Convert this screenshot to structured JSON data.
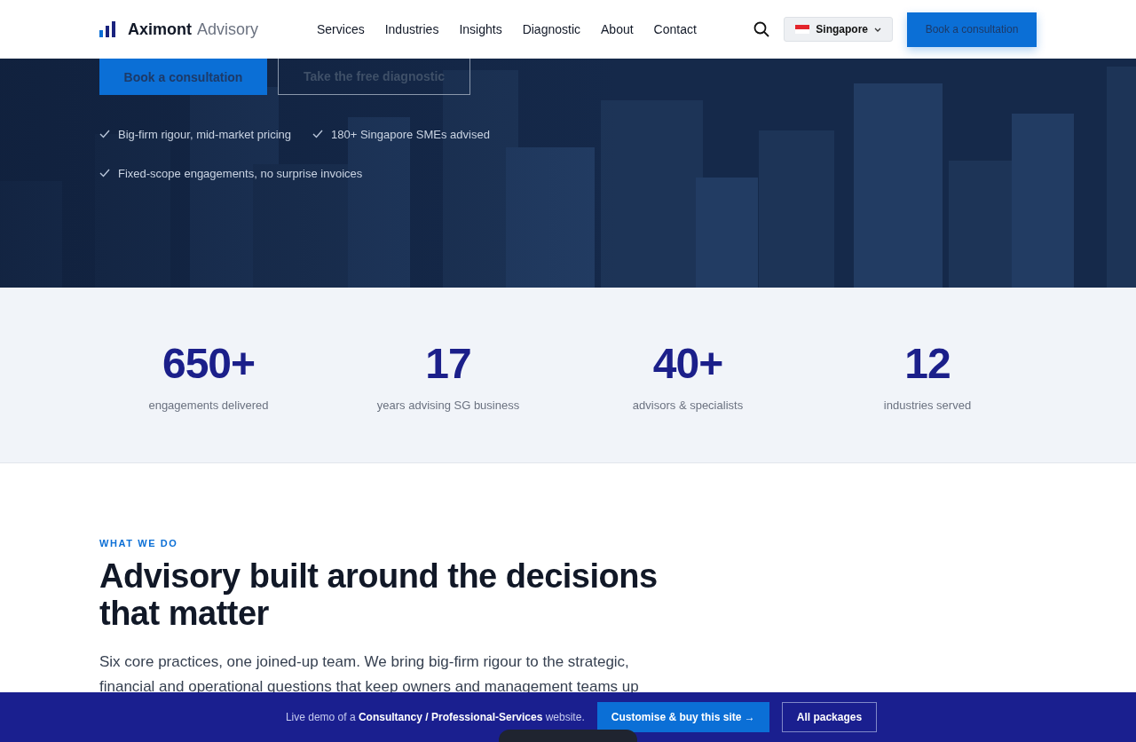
{
  "header": {
    "brand": {
      "name": "Aximont",
      "suffix": "Advisory"
    },
    "nav": [
      {
        "label": "Services"
      },
      {
        "label": "Industries"
      },
      {
        "label": "Insights"
      },
      {
        "label": "Diagnostic"
      },
      {
        "label": "About"
      },
      {
        "label": "Contact"
      }
    ],
    "region": "Singapore",
    "cta": "Book a consultation"
  },
  "hero": {
    "buttons": [
      {
        "label": "Book a consultation",
        "kind": "primary"
      },
      {
        "label": "Take the free diagnostic",
        "kind": "outline"
      }
    ],
    "points": [
      "Big-firm rigour, mid-market pricing",
      "180+ Singapore SMEs advised",
      "Fixed-scope engagements, no surprise invoices"
    ]
  },
  "stats": [
    {
      "value": "650+",
      "label": "engagements delivered"
    },
    {
      "value": "17",
      "label": "years advising SG business"
    },
    {
      "value": "40+",
      "label": "advisors & specialists"
    },
    {
      "value": "12",
      "label": "industries served"
    }
  ],
  "section": {
    "eyebrow": "WHAT WE DO",
    "title": "Advisory built around the decisions that matter",
    "body": "Six core practices, one joined-up team. We bring big-firm rigour to the strategic, financial and operational questions that keep owners and management teams up"
  },
  "banner": {
    "text": "Live demo of a **Consultancy / Professional-Services** website.",
    "buttons": [
      {
        "label": "Customise & buy this site →",
        "kind": "primary"
      },
      {
        "label": "All packages",
        "kind": "outline"
      }
    ]
  }
}
